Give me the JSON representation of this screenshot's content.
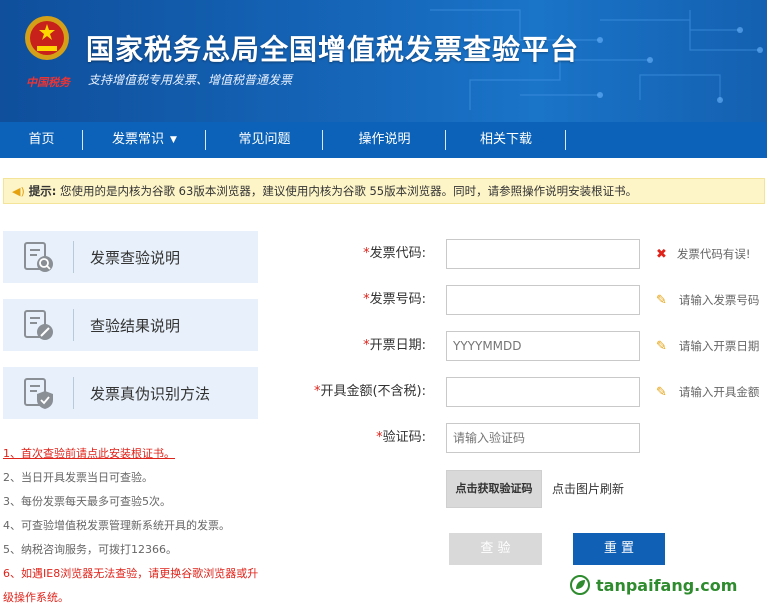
{
  "header": {
    "emblem_text": "中国税务",
    "title": "国家税务总局全国增值税发票查验平台",
    "subtitle": "支持增值税专用发票、增值税普通发票"
  },
  "nav": {
    "items": [
      {
        "label": "首页"
      },
      {
        "label": "发票常识"
      },
      {
        "label": "常见问题"
      },
      {
        "label": "操作说明"
      },
      {
        "label": "相关下载"
      }
    ]
  },
  "notice": {
    "prefix": "提示:",
    "text": "您使用的是内核为谷歌 63版本浏览器，建议使用内核为谷歌 55版本浏览器。同时，请参照操作说明安装根证书。"
  },
  "cards": [
    {
      "label": "发票查验说明",
      "icon": "search-doc-icon"
    },
    {
      "label": "查验结果说明",
      "icon": "edit-doc-icon"
    },
    {
      "label": "发票真伪识别方法",
      "icon": "shield-doc-icon"
    }
  ],
  "notes": [
    {
      "text": "1、首次查验前请点此安装根证书。"
    },
    {
      "text": "2、当日开具发票当日可查验。"
    },
    {
      "text": "3、每份发票每天最多可查验5次。"
    },
    {
      "text": "4、可查验增值税发票管理新系统开具的发票。"
    },
    {
      "text": "5、纳税咨询服务，可拨打12366。"
    },
    {
      "text": "6、如遇IE8浏览器无法查验，请更换谷歌浏览器或升"
    },
    {
      "text": "级操作系统。"
    }
  ],
  "form": {
    "code": {
      "required": "*",
      "label": "发票代码:",
      "value": "",
      "hint": "发票代码有误!"
    },
    "number": {
      "required": "*",
      "label": "发票号码:",
      "value": "",
      "hint": "请输入发票号码"
    },
    "date": {
      "required": "*",
      "label": "开票日期:",
      "placeholder": "YYYYMMDD",
      "hint": "请输入开票日期"
    },
    "amount": {
      "required": "*",
      "label": "开具金额(不含税):",
      "value": "",
      "hint": "请输入开具金额"
    },
    "captcha": {
      "required": "*",
      "label": "验证码:",
      "placeholder": "请输入验证码"
    }
  },
  "captcha_image": {
    "text": "点击获取验证码",
    "refresh": "点击图片刷新"
  },
  "buttons": {
    "check": "查 验",
    "reset": "重 置"
  },
  "watermark": "tanpaifang.com",
  "colors": {
    "nav": "#0b62b8",
    "accent": "#1060b5",
    "error": "#e0231a"
  }
}
